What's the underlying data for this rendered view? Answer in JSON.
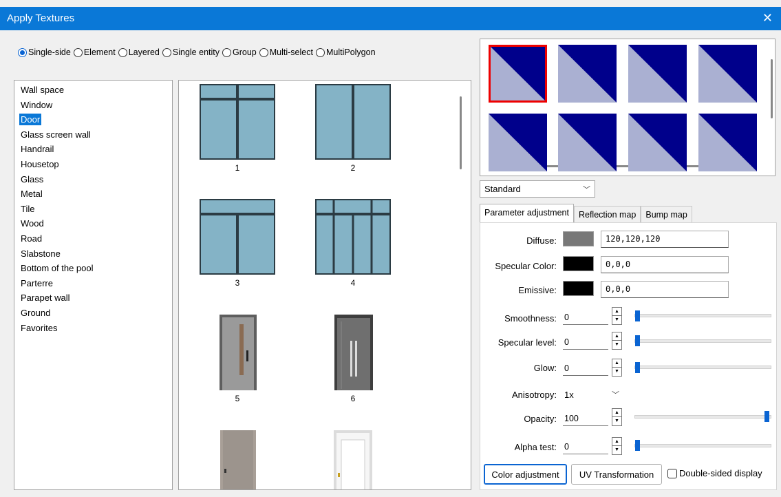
{
  "window": {
    "title": "Apply Textures",
    "close_glyph": "✕"
  },
  "modes": [
    {
      "label": "Single-side",
      "checked": true
    },
    {
      "label": "Element",
      "checked": false
    },
    {
      "label": "Layered",
      "checked": false
    },
    {
      "label": "Single entity",
      "checked": false
    },
    {
      "label": "Group",
      "checked": false
    },
    {
      "label": "Multi-select",
      "checked": false
    },
    {
      "label": "MultiPolygon",
      "checked": false
    }
  ],
  "categories": [
    "Wall space",
    "Window",
    "Door",
    "Glass screen wall",
    "Handrail",
    "Housetop",
    "Glass",
    "Metal",
    "Tile",
    "Wood",
    "Road",
    "Slabstone",
    "Bottom of the pool",
    "Parterre",
    "Parapet wall",
    "Ground",
    "Favorites"
  ],
  "selected_category": "Door",
  "textures": [
    {
      "caption": "1",
      "kind": "window-a"
    },
    {
      "caption": "2",
      "kind": "window-b"
    },
    {
      "caption": "3",
      "kind": "window-c"
    },
    {
      "caption": "4",
      "kind": "window-d"
    },
    {
      "caption": "5",
      "kind": "door-grey"
    },
    {
      "caption": "6",
      "kind": "door-dark"
    },
    {
      "caption": "",
      "kind": "door-wood"
    },
    {
      "caption": "",
      "kind": "door-white"
    }
  ],
  "material_type": "Standard",
  "tabs": [
    {
      "label": "Parameter adjustment",
      "active": true
    },
    {
      "label": "Reflection map",
      "active": false
    },
    {
      "label": "Bump map",
      "active": false
    }
  ],
  "params": {
    "diffuse": {
      "label": "Diffuse:",
      "color": "#787878",
      "value": "120,120,120"
    },
    "specular": {
      "label": "Specular Color:",
      "color": "#000000",
      "value": "0,0,0"
    },
    "emissive": {
      "label": "Emissive:",
      "color": "#000000",
      "value": "0,0,0"
    },
    "smoothness": {
      "label": "Smoothness:",
      "value": "0"
    },
    "specular_level": {
      "label": "Specular level:",
      "value": "0"
    },
    "glow": {
      "label": "Glow:",
      "value": "0"
    },
    "anisotropy": {
      "label": "Anisotropy:",
      "value": "1x"
    },
    "opacity": {
      "label": "Opacity:",
      "value": "100"
    },
    "alpha_test": {
      "label": "Alpha test:",
      "value": "0"
    }
  },
  "buttons": {
    "color_adjustment": "Color adjustment",
    "uv_transformation": "UV Transformation",
    "double_sided": "Double-sided display"
  },
  "colors": {
    "accent": "#0a78d7",
    "swatch_dark": "#00008b",
    "swatch_light": "#aab0d2",
    "selection": "#e00000"
  }
}
